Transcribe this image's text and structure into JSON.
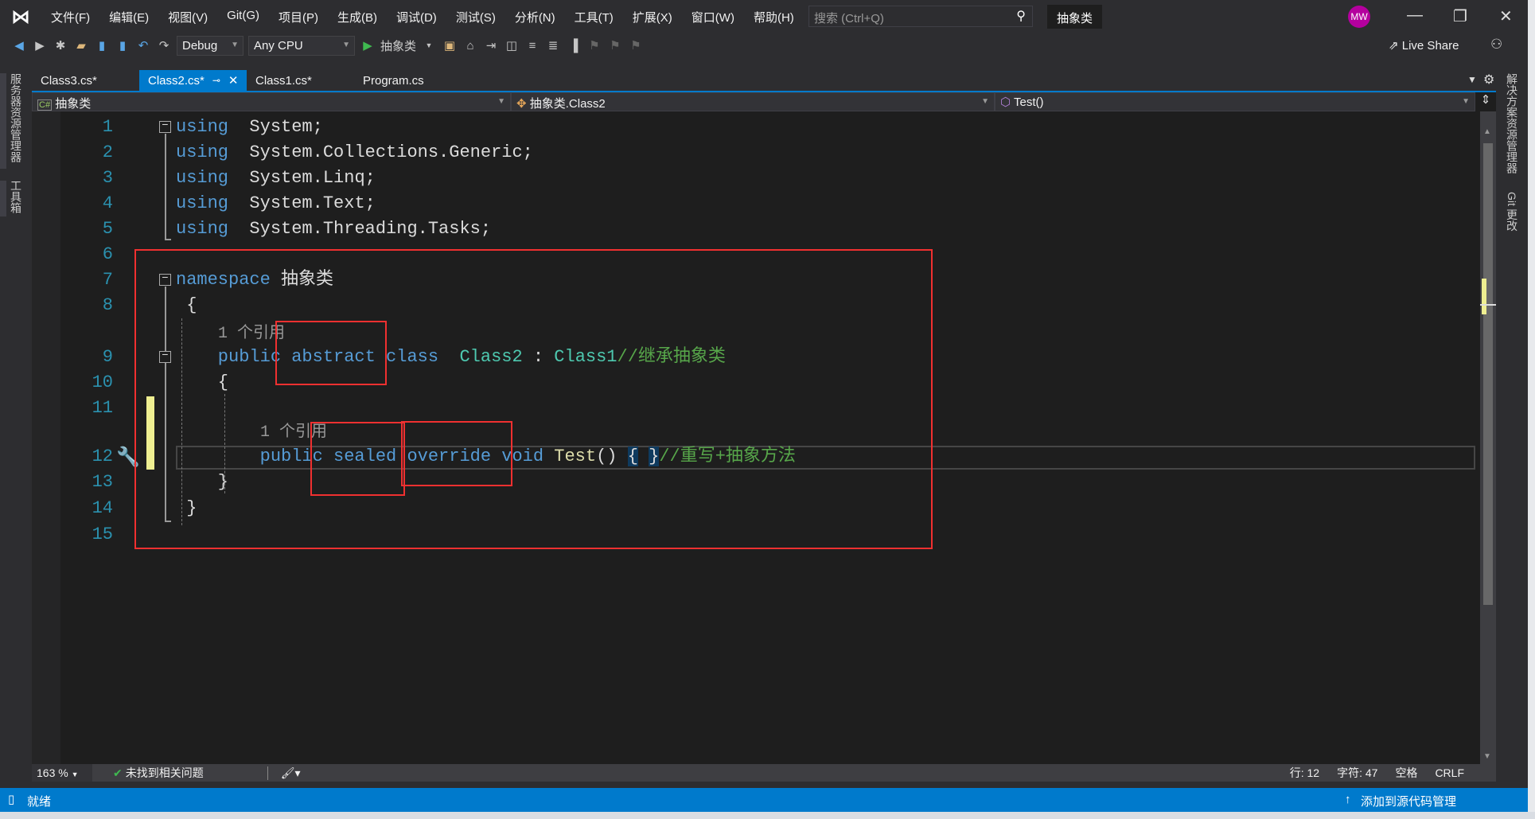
{
  "titlebar": {
    "menus": [
      "文件(F)",
      "编辑(E)",
      "视图(V)",
      "Git(G)",
      "项目(P)",
      "生成(B)",
      "调试(D)",
      "测试(S)",
      "分析(N)",
      "工具(T)",
      "扩展(X)",
      "窗口(W)",
      "帮助(H)"
    ],
    "search_placeholder": "搜索 (Ctrl+Q)",
    "solution": "抽象类",
    "avatar": "MW"
  },
  "toolbar": {
    "config": "Debug",
    "platform": "Any CPU",
    "start": "抽象类",
    "live_share": "Live Share"
  },
  "left_tabs": [
    "服务器资源管理器",
    "工具箱"
  ],
  "right_tabs": [
    "解决方案资源管理器",
    "Git 更改"
  ],
  "tabs": [
    {
      "label": "Class3.cs*"
    },
    {
      "label": "Class2.cs*",
      "active": true
    },
    {
      "label": "Class1.cs*"
    },
    {
      "label": "Program.cs"
    }
  ],
  "navbar": {
    "project": "抽象类",
    "type": "抽象类.Class2",
    "member": "Test()"
  },
  "code": {
    "lines": [
      {
        "n": "1",
        "tokens": [
          [
            "kw",
            "using"
          ],
          [
            "",
            "  System;"
          ]
        ]
      },
      {
        "n": "2",
        "tokens": [
          [
            "kw",
            "using"
          ],
          [
            "",
            "  System.Collections.Generic;"
          ]
        ]
      },
      {
        "n": "3",
        "tokens": [
          [
            "kw",
            "using"
          ],
          [
            "",
            "  System.Linq;"
          ]
        ]
      },
      {
        "n": "4",
        "tokens": [
          [
            "kw",
            "using"
          ],
          [
            "",
            "  System.Text;"
          ]
        ]
      },
      {
        "n": "5",
        "tokens": [
          [
            "kw",
            "using"
          ],
          [
            "",
            "  System.Threading.Tasks;"
          ]
        ]
      },
      {
        "n": "6",
        "tokens": []
      },
      {
        "n": "7",
        "tokens": [
          [
            "kw",
            "namespace"
          ],
          [
            "",
            " 抽象类"
          ]
        ]
      },
      {
        "n": "8",
        "tokens": [
          [
            "",
            " {"
          ]
        ]
      },
      {
        "n": "9",
        "tokens": [
          [
            "kw",
            "    public abstract class"
          ],
          [
            "",
            "  "
          ],
          [
            "ty",
            "Class2"
          ],
          [
            "",
            " : "
          ],
          [
            "ty",
            "Class1"
          ],
          [
            "cm",
            "//继承抽象类"
          ]
        ]
      },
      {
        "n": "10",
        "tokens": [
          [
            "",
            "    {"
          ]
        ]
      },
      {
        "n": "11",
        "tokens": []
      },
      {
        "n": "12",
        "tokens": [
          [
            "kw",
            "        public sealed override void"
          ],
          [
            "",
            " "
          ],
          [
            "fn",
            "Test"
          ],
          [
            "",
            "() "
          ],
          [
            "br",
            "{"
          ],
          [
            "",
            " "
          ],
          [
            "br",
            "}"
          ],
          [
            "cm",
            "//重写+抽象方法"
          ]
        ]
      },
      {
        "n": "13",
        "tokens": [
          [
            "",
            "    }"
          ]
        ]
      },
      {
        "n": "14",
        "tokens": [
          [
            "",
            " }"
          ]
        ]
      },
      {
        "n": "15",
        "tokens": []
      }
    ],
    "codelens": [
      "1 个引用",
      "1 个引用"
    ]
  },
  "status_editor": {
    "zoom": "163 %",
    "issues": "未找到相关问题",
    "line": "行: 12",
    "col": "字符: 47",
    "spaces": "空格",
    "eol": "CRLF"
  },
  "statusbar": {
    "ready": "就绪",
    "source_control": "添加到源代码管理"
  },
  "colors": {
    "accent": "#007acc",
    "annotation": "#f03030",
    "keyword": "#569cd6",
    "type": "#4ec9b0",
    "comment": "#57a64a"
  }
}
